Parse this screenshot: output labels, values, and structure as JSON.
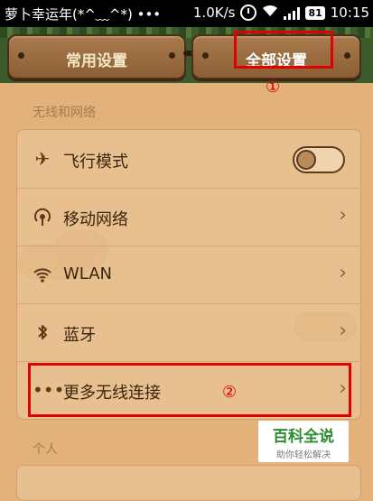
{
  "status_bar": {
    "left_text": "萝卜幸运年(*^﹏^*) •••",
    "speed": "1.0K/s",
    "battery": "81",
    "time": "10:15"
  },
  "tabs": {
    "common_label": "常用设置",
    "all_label": "全部设置"
  },
  "annotations": {
    "marker1": "①",
    "marker2": "②"
  },
  "sections": {
    "wireless_header": "无线和网络",
    "personal_header": "个人"
  },
  "wireless_items": [
    {
      "label": "飞行模式",
      "icon": "airplane-icon"
    },
    {
      "label": "移动网络",
      "icon": "mobile-network-icon"
    },
    {
      "label": "WLAN",
      "icon": "wifi-icon"
    },
    {
      "label": "蓝牙",
      "icon": "bluetooth-icon"
    },
    {
      "label": "更多无线连接",
      "icon": "more-icon"
    }
  ],
  "toggle": {
    "airplane_mode": "off"
  },
  "watermark": {
    "title": "百科全说",
    "subtitle": "助你轻松解决"
  },
  "colors": {
    "background": "#e3b27a",
    "annotation_red": "#e30000",
    "watermark_green": "#2c8b2e"
  }
}
